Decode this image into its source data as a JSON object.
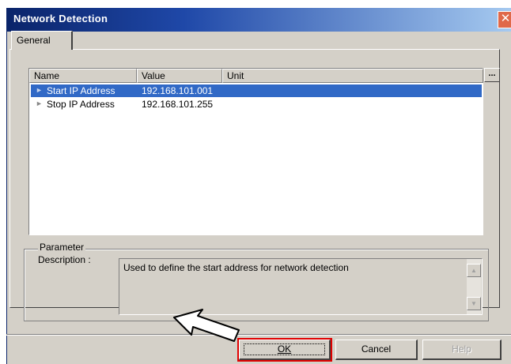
{
  "window": {
    "title": "Network Detection",
    "close_glyph": "✕"
  },
  "tabs": [
    {
      "label": "General",
      "selected": true
    }
  ],
  "list": {
    "columns": [
      "Name",
      "Value",
      "Unit"
    ],
    "rows": [
      {
        "name": "Start IP Address",
        "value": "192.168.101.001",
        "unit": "",
        "selected": true
      },
      {
        "name": "Stop IP Address",
        "value": "192.168.101.255",
        "unit": "",
        "selected": false
      }
    ],
    "ellipsis_label": "..."
  },
  "parameter": {
    "group_label": "Parameter",
    "description_label": "Description :",
    "description_text": "Used to define the start address for network detection"
  },
  "buttons": {
    "ok": {
      "label": "OK",
      "mnemonic": "O",
      "highlighted": true
    },
    "cancel": {
      "label": "Cancel",
      "mnemonic": "C"
    },
    "help": {
      "label": "Help",
      "mnemonic": "H",
      "disabled": true
    }
  },
  "icons": {
    "row_expander": "row-pointer-icon",
    "annotation": "callout-arrow-icon",
    "scroll_up": "scroll-up-icon",
    "scroll_down": "scroll-down-icon"
  },
  "colors": {
    "title_start": "#0a246a",
    "title_end": "#a6caf0",
    "selection": "#3169c6",
    "dialog_face": "#d4d0c8",
    "ok_highlight": "#e00000",
    "close_button": "#e0694a"
  }
}
